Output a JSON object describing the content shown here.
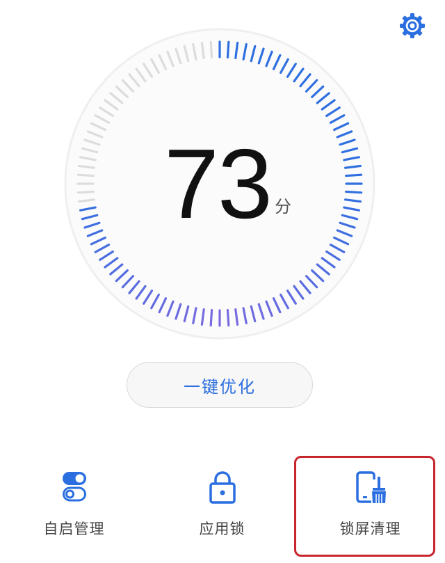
{
  "score": {
    "value": "73",
    "unit": "分",
    "fraction": 0.73
  },
  "optimize_button": {
    "label": "一键优化"
  },
  "bottom_items": [
    {
      "label": "自启管理",
      "icon": "toggle-switch-icon"
    },
    {
      "label": "应用锁",
      "icon": "padlock-icon"
    },
    {
      "label": "锁屏清理",
      "icon": "phone-broom-icon"
    }
  ],
  "header": {
    "settings_icon": "gear-icon"
  },
  "colors": {
    "accent": "#2a6ee0",
    "gauge_blue": "#2f6fe0",
    "gauge_purple": "#7c6be0",
    "gauge_inactive": "#dcdcdc",
    "highlight": "#c8252f"
  }
}
